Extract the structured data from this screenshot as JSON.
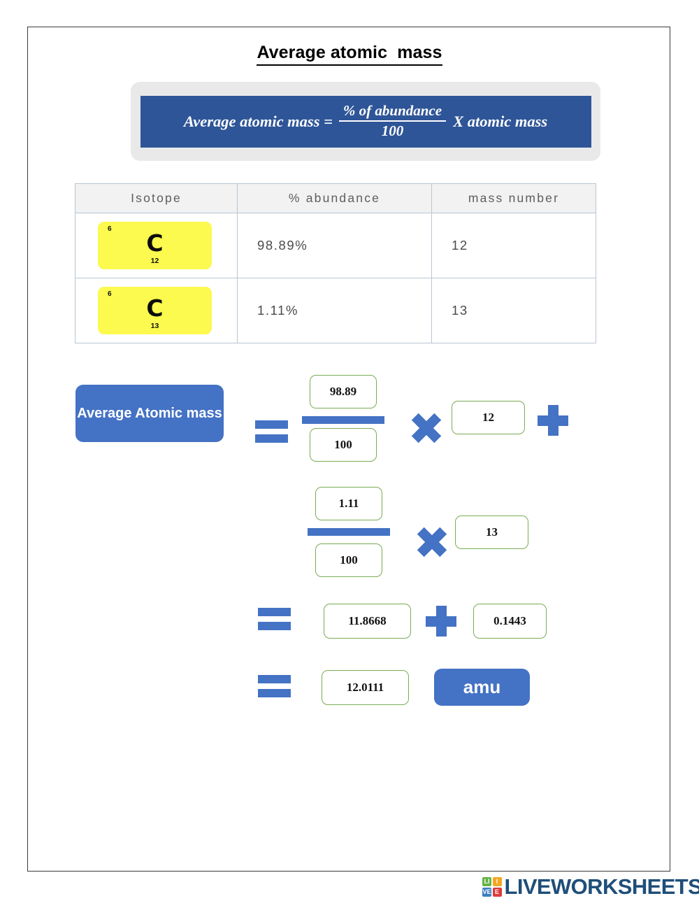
{
  "title": "Average atomic  mass",
  "formula": {
    "lhs": "Average atomic mass =",
    "numerator": "% of abundance",
    "denominator": "100",
    "rhs": "X atomic mass",
    "banner_color": "#2e5597",
    "banner_frame_color": "#e9e9e9"
  },
  "table": {
    "headers": [
      "Isotope",
      "% abundance",
      "mass number"
    ],
    "rows": [
      {
        "isotope": {
          "atomic_number": "6",
          "symbol": "C",
          "mass_number": "12",
          "chip_color": "#fcf94f"
        },
        "abundance": "98.89%",
        "mass_number": "12"
      },
      {
        "isotope": {
          "atomic_number": "6",
          "symbol": "C",
          "mass_number": "13",
          "chip_color": "#fcf94f"
        },
        "abundance": "1.11%",
        "mass_number": "13"
      }
    ]
  },
  "calculation": {
    "label": "Average Atomic mass",
    "unit_label": "amu",
    "accent_blue": "#4472c4",
    "input_border_color": "#7aac53",
    "row1": {
      "numerator": "98.89",
      "denominator": "100",
      "factor": "12"
    },
    "row2": {
      "numerator": "1.11",
      "denominator": "100",
      "factor": "13"
    },
    "row3": {
      "term1": "11.8668",
      "term2": "0.1443"
    },
    "row4": {
      "result": "12.0111"
    }
  },
  "footer": {
    "logo_tiles": [
      {
        "letter": "LI",
        "color": "#64b445"
      },
      {
        "letter": "I",
        "color": "#f5a623"
      },
      {
        "letter": "VE",
        "color": "#3d7fc1"
      },
      {
        "letter": "E",
        "color": "#e03a3a"
      }
    ],
    "brand": "LIVEWORKSHEETS",
    "brand_color": "#1f4e79"
  }
}
